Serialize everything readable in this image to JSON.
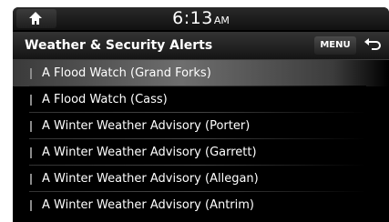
{
  "status": {
    "time": "6:13",
    "ampm": "AM"
  },
  "header": {
    "title": "Weather & Security Alerts",
    "menu_label": "MENU"
  },
  "alerts": [
    {
      "label": "A Flood Watch (Grand Forks)"
    },
    {
      "label": "A Flood Watch (Cass)"
    },
    {
      "label": "A Winter Weather Advisory (Porter)"
    },
    {
      "label": "A Winter Weather Advisory (Garrett)"
    },
    {
      "label": "A Winter Weather Advisory (Allegan)"
    },
    {
      "label": "A Winter Weather Advisory (Antrim)"
    }
  ],
  "icons": {
    "home": "home-icon",
    "back": "back-arrow-icon"
  },
  "colors": {
    "background": "#000000",
    "text": "#ffffff",
    "selected_highlight": "#6e6e6e"
  }
}
